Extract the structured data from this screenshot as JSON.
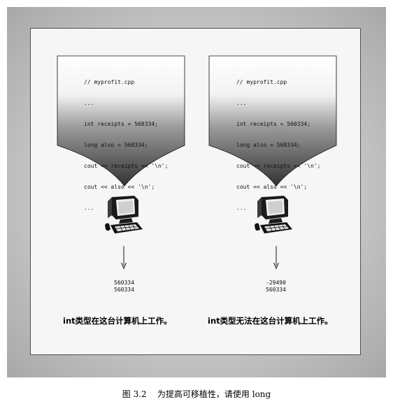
{
  "figure": {
    "caption": "图 3.2    为提高可移植性，请使用 long"
  },
  "panels": [
    {
      "code_lines": [
        "// myprofit.cpp",
        "...",
        "int receipts = 560334;",
        "long also = 560334;",
        "cout << receipts << '\\n';",
        "cout << also << '\\n';",
        "..."
      ],
      "output": [
        "560334",
        "560334"
      ],
      "result_label": "int类型在这台计算机上工作。"
    },
    {
      "code_lines": [
        "// myprofit.cpp",
        "...",
        "int receipts = 560334;",
        "long also = 560334;",
        "cout << receipts << '\\n';",
        "cout << also << '\\n';",
        "..."
      ],
      "output": [
        "-29490",
        "560334"
      ],
      "result_label": "int类型无法在这台计算机上工作。"
    }
  ],
  "icons": {
    "computer": "computer-icon",
    "arrow": "arrow-down-icon"
  },
  "colors": {
    "panel_background": "#f6f6f6",
    "bubble_top": "#ffffff",
    "bubble_bottom": "#3a3a3a",
    "frame_shadow": "#a8a8a8",
    "computer": "#1a1a1a"
  }
}
